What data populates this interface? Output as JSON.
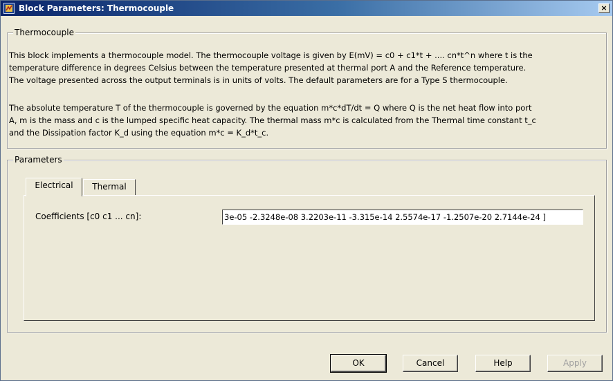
{
  "window": {
    "title": "Block Parameters: Thermocouple",
    "close_label": "×"
  },
  "description_group": {
    "legend": "Thermocouple",
    "paragraph1_lines": [
      "This block implements a thermocouple model. The thermocouple voltage is given by E(mV) = c0 + c1*t + .... cn*t^n where t is the",
      "temperature difference in degrees Celsius between the temperature presented at thermal port A and the Reference temperature.",
      "The voltage presented across the output terminals is in units of volts. The default parameters are for a Type S thermocouple."
    ],
    "paragraph2_lines": [
      "The absolute temperature T of the thermocouple is governed by the equation m*c*dT/dt = Q where Q is the net heat flow into port",
      "A, m is the mass and c is the lumped specific heat capacity. The thermal mass m*c is calculated from the Thermal time constant t_c",
      "and the Dissipation factor K_d using the equation m*c = K_d*t_c."
    ]
  },
  "parameters_group": {
    "legend": "Parameters",
    "tabs": [
      {
        "label": "Electrical",
        "active": true
      },
      {
        "label": "Thermal",
        "active": false
      }
    ],
    "fields": [
      {
        "label": "Coefficients [c0 c1 ... cn]:",
        "value": "3e-05 -2.3248e-08 3.2203e-11 -3.315e-14 2.5574e-17 -1.2507e-20 2.7144e-24 ]"
      }
    ]
  },
  "buttons": {
    "ok": "OK",
    "cancel": "Cancel",
    "help": "Help",
    "apply": "Apply"
  },
  "colors": {
    "title_bar_start": "#0a246a",
    "title_bar_end": "#a6caf0",
    "dialog_background": "#ece9d8",
    "disabled_text": "#a0a0a0"
  }
}
